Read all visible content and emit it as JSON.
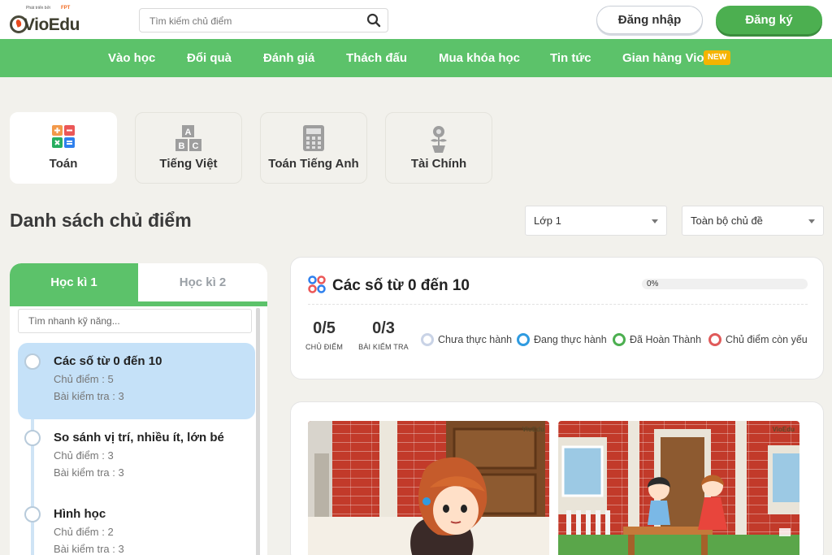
{
  "logo": {
    "tagline": "Phát triển bởi",
    "partner": "FPT",
    "name": "VioEdu"
  },
  "search": {
    "placeholder": "Tìm kiếm chủ điểm",
    "icon": "search-icon"
  },
  "auth": {
    "login": "Đăng nhập",
    "register": "Đăng ký"
  },
  "nav": {
    "items": [
      "Vào học",
      "Đổi quà",
      "Đánh giá",
      "Thách đấu",
      "Mua khóa học",
      "Tin tức",
      "Gian hàng Vio"
    ],
    "badge": "NEW"
  },
  "subjects": [
    {
      "label": "Toán",
      "icon": "math-operators-icon",
      "active": true
    },
    {
      "label": "Tiếng Việt",
      "icon": "abc-blocks-icon",
      "active": false
    },
    {
      "label": "Toán Tiếng Anh",
      "icon": "calculator-icon",
      "active": false
    },
    {
      "label": "Tài Chính",
      "icon": "coin-plant-icon",
      "active": false
    }
  ],
  "page_title": "Danh sách chủ điểm",
  "filters": {
    "grade": "Lớp 1",
    "topic": "Toàn bộ chủ đề"
  },
  "semester_tabs": [
    "Học kì 1",
    "Học kì 2"
  ],
  "skill_filter_placeholder": "Tìm nhanh kỹ năng...",
  "topics": [
    {
      "title": "Các số từ 0 đến 10",
      "chu_diem": "Chủ điểm : 5",
      "bai_kiem_tra": "Bài kiểm tra : 3"
    },
    {
      "title": "So sánh vị trí, nhiều ít, lớn bé",
      "chu_diem": "Chủ điểm : 3",
      "bai_kiem_tra": "Bài kiểm tra : 3"
    },
    {
      "title": "Hình học",
      "chu_diem": "Chủ điểm : 2",
      "bai_kiem_tra": "Bài kiểm tra : 3"
    }
  ],
  "selected": {
    "title": "Các số từ 0 đến 10",
    "progress_label": "0%",
    "progress": 0,
    "chu_diem_value": "0/5",
    "chu_diem_label": "CHỦ ĐIỂM",
    "bai_kiem_tra_value": "0/3",
    "bai_kiem_tra_label": "BÀI KIỂM TRA"
  },
  "legend": [
    {
      "label": "Chưa thực hành",
      "color": "#c9d3e6"
    },
    {
      "label": "Đang thực hành",
      "color": "#2f9be0"
    },
    {
      "label": "Đã Hoàn Thành",
      "color": "#4caf50"
    },
    {
      "label": "Chủ điểm còn yếu",
      "color": "#e05a5a"
    }
  ],
  "video_watermark": "VioEdu"
}
